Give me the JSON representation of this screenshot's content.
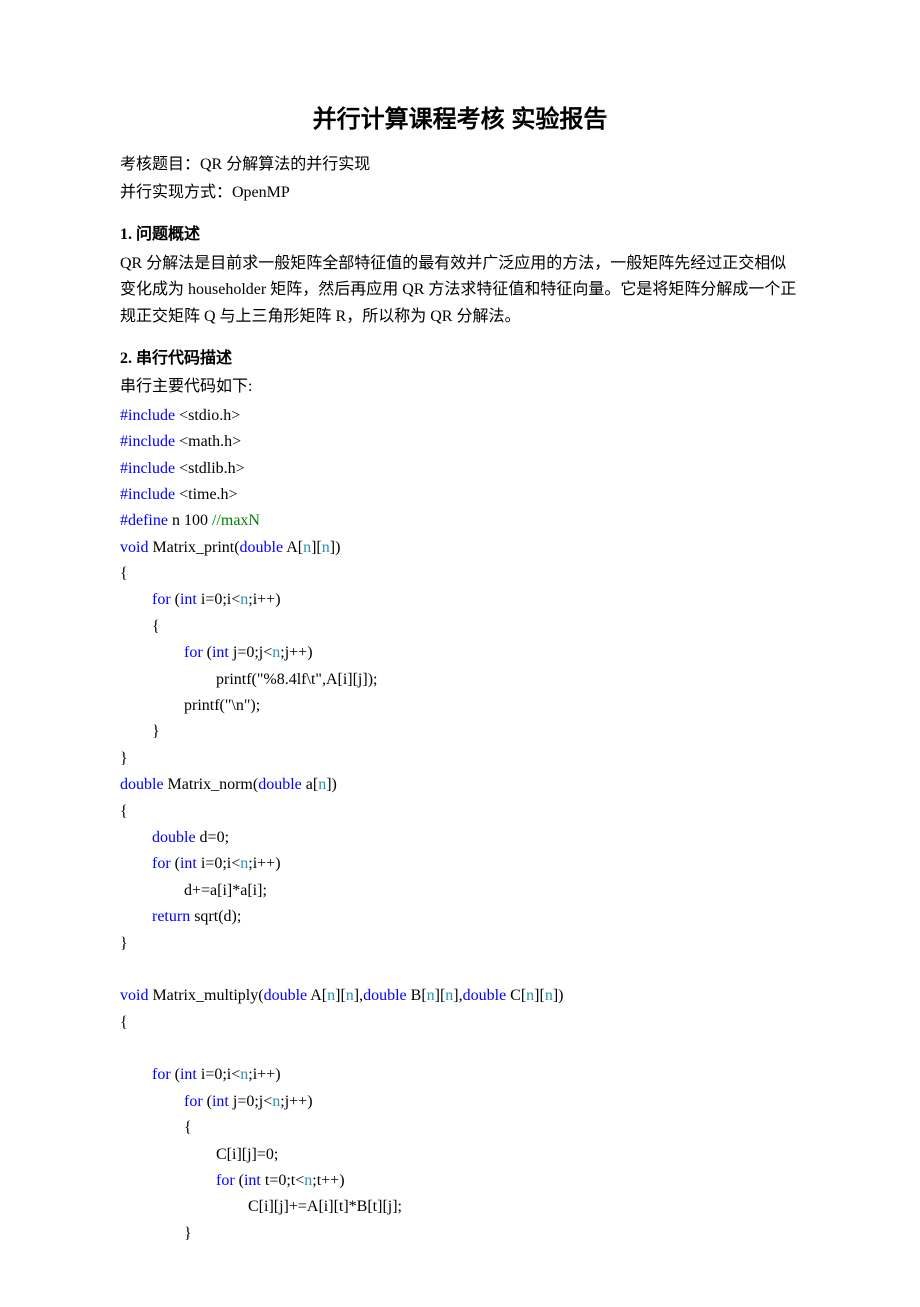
{
  "title": "并行计算课程考核 实验报告",
  "meta": {
    "line1": "考核题目：QR 分解算法的并行实现",
    "line2": "并行实现方式：OpenMP"
  },
  "section1": {
    "heading": "1. 问题概述",
    "body": "QR 分解法是目前求一般矩阵全部特征值的最有效并广泛应用的方法，一般矩阵先经过正交相似变化成为 householder 矩阵，然后再应用 QR 方法求特征值和特征向量。它是将矩阵分解成一个正规正交矩阵 Q 与上三角形矩阵 R，所以称为 QR 分解法。"
  },
  "section2": {
    "heading": "2. 串行代码描述",
    "intro": "串行主要代码如下:"
  },
  "code": {
    "inc1a": "#include",
    "inc1b": " <stdio.h>",
    "inc2a": "#include",
    "inc2b": " <math.h>",
    "inc3a": "#include",
    "inc3b": " <stdlib.h>",
    "inc4a": "#include",
    "inc4b": " <time.h>",
    "def1a": "#define",
    "def1b": " n 100 ",
    "def1c": "//maxN",
    "fn1_l1a": "void",
    "fn1_l1b": " Matrix_print(",
    "fn1_l1c": "double",
    "fn1_l1d": " A[",
    "fn1_l1e": "n",
    "fn1_l1f": "][",
    "fn1_l1g": "n",
    "fn1_l1h": "])",
    "fn1_l2": "{",
    "fn1_l3a": "        for",
    "fn1_l3b": " (",
    "fn1_l3c": "int",
    "fn1_l3d": " i=0;i<",
    "fn1_l3e": "n",
    "fn1_l3f": ";i++)",
    "fn1_l4": "        {",
    "fn1_l5a": "                for",
    "fn1_l5b": " (",
    "fn1_l5c": "int",
    "fn1_l5d": " j=0;j<",
    "fn1_l5e": "n",
    "fn1_l5f": ";j++)",
    "fn1_l6a": "                        printf(",
    "fn1_l6b": "\"%8.4lf\\t\"",
    "fn1_l6c": ",A[i][j]);",
    "fn1_l7a": "                printf(",
    "fn1_l7b": "\"\\n\"",
    "fn1_l7c": ");",
    "fn1_l8": "        }",
    "fn1_l9": "}",
    "fn2_l1a": "double",
    "fn2_l1b": " Matrix_norm(",
    "fn2_l1c": "double",
    "fn2_l1d": " a[",
    "fn2_l1e": "n",
    "fn2_l1f": "])",
    "fn2_l2": "{",
    "fn2_l3a": "        double",
    "fn2_l3b": " d=0;",
    "fn2_l4a": "        for",
    "fn2_l4b": " (",
    "fn2_l4c": "int",
    "fn2_l4d": " i=0;i<",
    "fn2_l4e": "n",
    "fn2_l4f": ";i++)",
    "fn2_l5": "                d+=a[i]*a[i];",
    "fn2_l6a": "        return",
    "fn2_l6b": " sqrt(d);",
    "fn2_l7": "}",
    "fn3_l1a": "void",
    "fn3_l1b": " Matrix_multiply(",
    "fn3_l1c": "double",
    "fn3_l1d": " A[",
    "fn3_l1e": "n",
    "fn3_l1f": "][",
    "fn3_l1g": "n",
    "fn3_l1h": "],",
    "fn3_l1i": "double",
    "fn3_l1j": " B[",
    "fn3_l1k": "n",
    "fn3_l1l": "][",
    "fn3_l1m": "n",
    "fn3_l1n": "],",
    "fn3_l1o": "double",
    "fn3_l1p": " C[",
    "fn3_l1q": "n",
    "fn3_l1r": "][",
    "fn3_l1s": "n",
    "fn3_l1t": "])",
    "fn3_l2": "{",
    "fn3_l3a": "        for",
    "fn3_l3b": " (",
    "fn3_l3c": "int",
    "fn3_l3d": " i=0;i<",
    "fn3_l3e": "n",
    "fn3_l3f": ";i++)",
    "fn3_l4a": "                for",
    "fn3_l4b": " (",
    "fn3_l4c": "int",
    "fn3_l4d": " j=0;j<",
    "fn3_l4e": "n",
    "fn3_l4f": ";j++)",
    "fn3_l5": "                {",
    "fn3_l6": "                        C[i][j]=0;",
    "fn3_l7a": "                        for",
    "fn3_l7b": " (",
    "fn3_l7c": "int",
    "fn3_l7d": " t=0;t<",
    "fn3_l7e": "n",
    "fn3_l7f": ";t++)",
    "fn3_l8": "                                C[i][j]+=A[i][t]*B[t][j];",
    "fn3_l9": "                }"
  }
}
